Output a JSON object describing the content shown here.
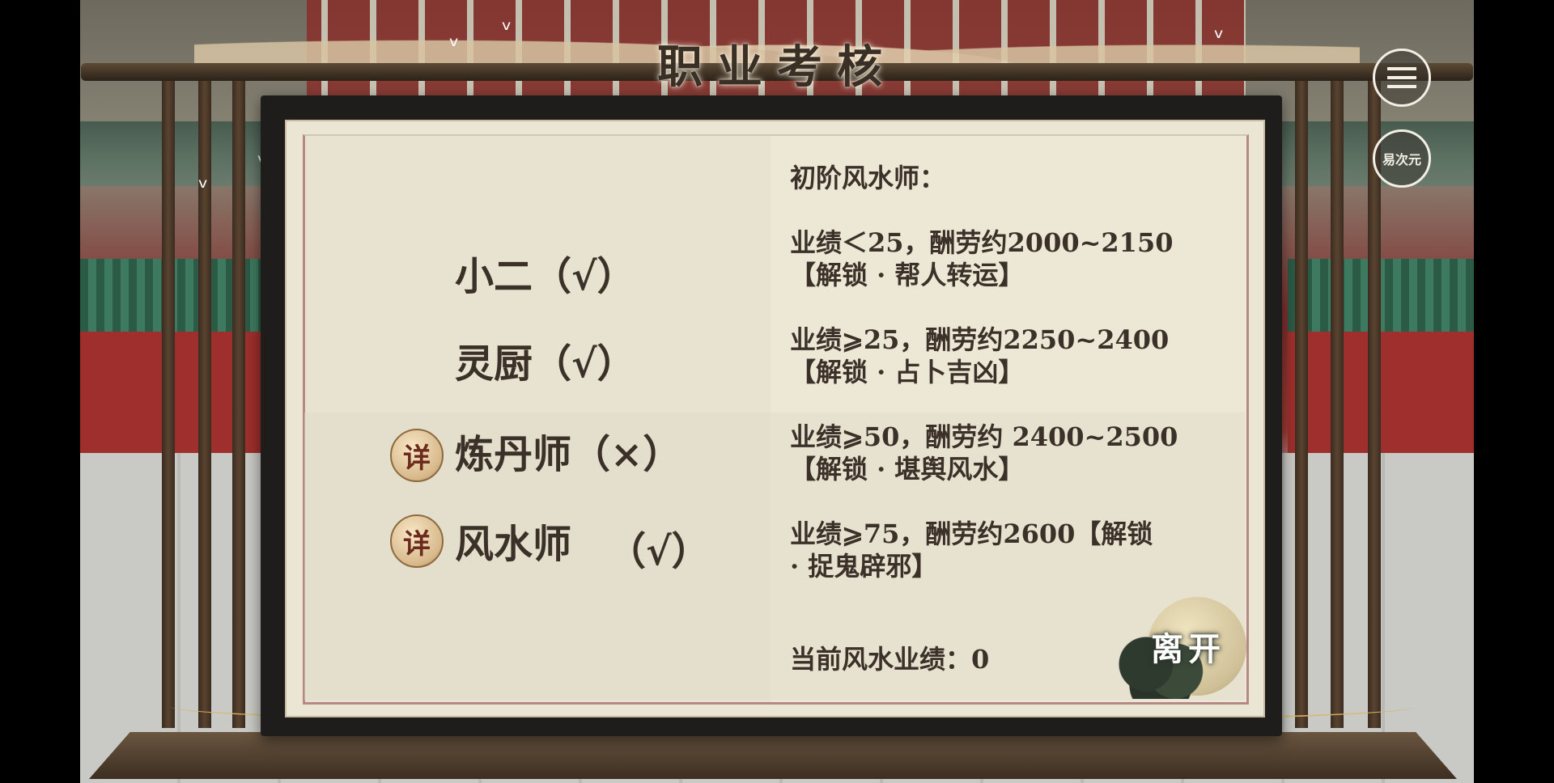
{
  "title": "职业考核",
  "icons": {
    "menu": "menu-lines-icon",
    "logo": "game-logo-icon"
  },
  "logo_text": "易次元",
  "jobs": [
    {
      "name": "小二（√）"
    },
    {
      "name": "灵厨（√）"
    },
    {
      "name": "炼丹师（×）",
      "detail": "详"
    },
    {
      "name": "风水师",
      "status": "（√）",
      "detail": "详"
    }
  ],
  "info": {
    "heading": "初阶风水师：",
    "tiers": [
      {
        "line1": "业绩＜25，酬劳约2000~2150",
        "line2": "【解锁 · 帮人转运】"
      },
      {
        "line1": "业绩⩾25，酬劳约2250~2400",
        "line2": "【解锁 · 占卜吉凶】"
      },
      {
        "line1": "业绩⩾50，酬劳约 2400~2500",
        "line2": "【解锁 · 堪舆风水】"
      },
      {
        "line1": "业绩⩾75，酬劳约2600【解锁",
        "line2": "· 捉鬼辟邪】"
      }
    ],
    "current": "当前风水业绩：0"
  },
  "leave_label": "离开",
  "colors": {
    "text": "#3b3129",
    "paper": "#ebe5d3",
    "frame": "#1f1d1b",
    "accent": "#b58a86"
  }
}
